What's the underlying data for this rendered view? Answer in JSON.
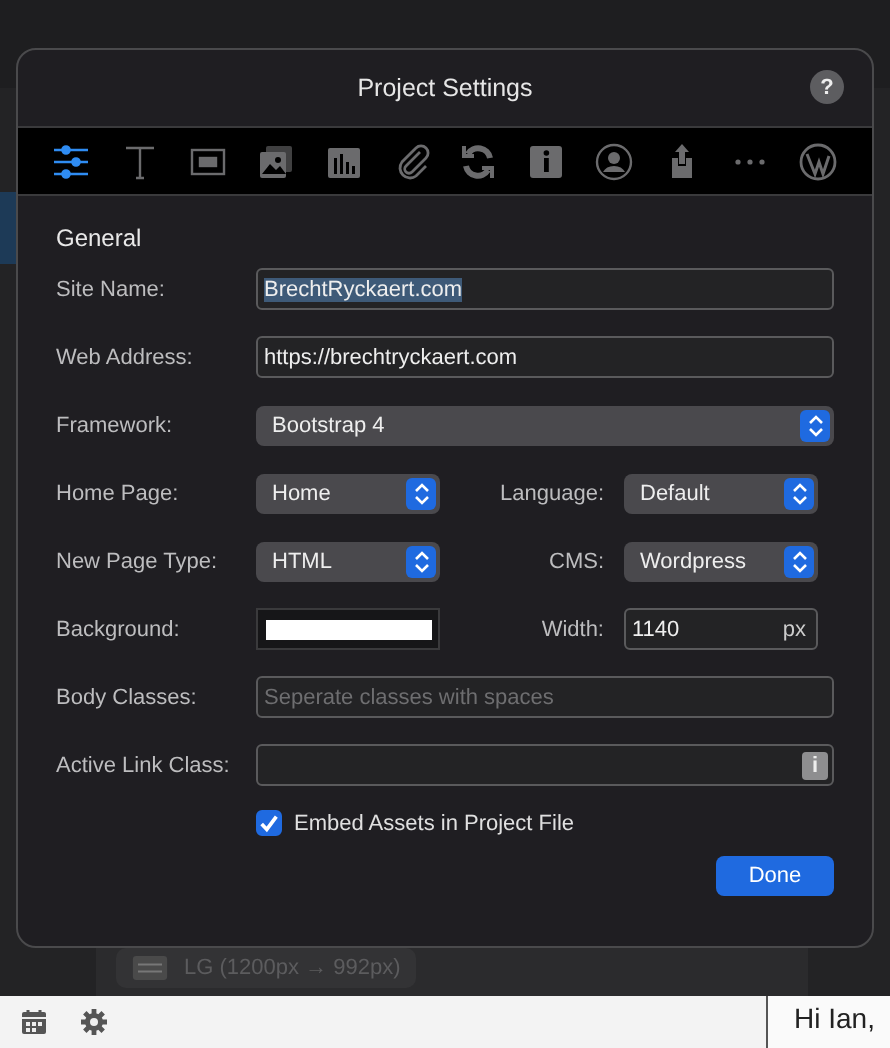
{
  "background_app": {
    "breakpoint": "LG (1200px → 992px)",
    "message_lines": [
      "Hi Ian,"
    ]
  },
  "dialog": {
    "title": "Project Settings",
    "help": "?",
    "tabs": [
      {
        "kind": "sliders",
        "selected": true
      },
      {
        "kind": "text",
        "selected": false
      },
      {
        "kind": "frame",
        "selected": false
      },
      {
        "kind": "images",
        "selected": false
      },
      {
        "kind": "chart",
        "selected": false
      },
      {
        "kind": "paperclip",
        "selected": false
      },
      {
        "kind": "refresh",
        "selected": false
      },
      {
        "kind": "info",
        "selected": false
      },
      {
        "kind": "person",
        "selected": false
      },
      {
        "kind": "upload",
        "selected": false
      },
      {
        "kind": "more",
        "selected": false
      },
      {
        "kind": "wordpress",
        "selected": false
      }
    ],
    "section": "General",
    "site_name": {
      "label": "Site Name:",
      "value": "BrechtRyckaert.com",
      "selected": true
    },
    "web_address": {
      "label": "Web Address:",
      "value": "https://brechtryckaert.com"
    },
    "framework": {
      "label": "Framework:",
      "value": "Bootstrap 4"
    },
    "home_page": {
      "label": "Home Page:",
      "value": "Home"
    },
    "language": {
      "label": "Language:",
      "value": "Default"
    },
    "new_page_type": {
      "label": "New Page Type:",
      "value": "HTML"
    },
    "cms": {
      "label": "CMS:",
      "value": "Wordpress"
    },
    "background": {
      "label": "Background:",
      "color": "#ffffff"
    },
    "width": {
      "label": "Width:",
      "value": "1140",
      "unit": "px"
    },
    "body_classes": {
      "label": "Body Classes:",
      "placeholder": "Seperate classes with spaces"
    },
    "active_link_class": {
      "label": "Active Link Class:",
      "info": "i"
    },
    "embed_assets": {
      "label": "Embed Assets in Project File",
      "checked": true
    },
    "done": "Done"
  }
}
